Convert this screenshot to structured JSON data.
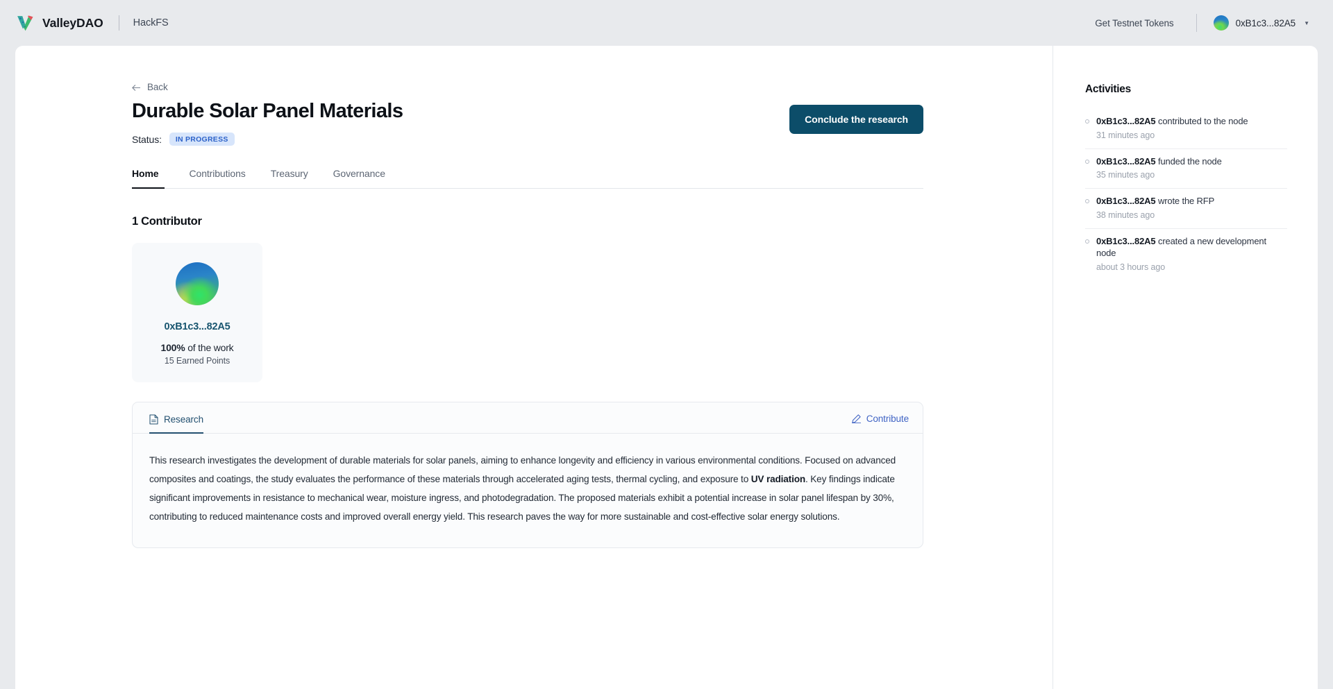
{
  "topbar": {
    "logo_icon": "valleydao-checkmark-logo",
    "brand_name": "ValleyDAO",
    "brand_sub": "HackFS",
    "testnet_link": "Get Testnet Tokens",
    "wallet_address": "0xB1c3...82A5",
    "caret_icon": "chevron-down-icon"
  },
  "page": {
    "back_label": "Back",
    "back_icon": "arrow-left-icon",
    "title": "Durable Solar Panel Materials",
    "status_label": "Status:",
    "status_value": "IN PROGRESS",
    "conclude_button": "Conclude the research"
  },
  "tabs": [
    {
      "label": "Home",
      "active": true
    },
    {
      "label": "Contributions",
      "active": false
    },
    {
      "label": "Treasury",
      "active": false
    },
    {
      "label": "Governance",
      "active": false
    }
  ],
  "contributors": {
    "heading": "1 Contributor",
    "cards": [
      {
        "avatar": "gradient-sphere-avatar",
        "address": "0xB1c3...82A5",
        "work_percent": "100%",
        "work_suffix": " of the work",
        "points": "15 Earned Points"
      }
    ]
  },
  "research": {
    "tab_label": "Research",
    "tab_icon": "document-icon",
    "contribute_label": "Contribute",
    "contribute_icon": "pencil-icon",
    "body_part1": "This research investigates the development of durable materials for solar panels, aiming to enhance longevity and efficiency in various environmental conditions. Focused on advanced composites and coatings, the study evaluates the performance of these materials through accelerated aging tests, thermal cycling, and exposure to ",
    "body_bold": "UV radiation",
    "body_part2": ". Key findings indicate significant improvements in resistance to mechanical wear, moisture ingress, and photodegradation. The proposed materials exhibit a potential increase in solar panel lifespan by 30%, contributing to reduced maintenance costs and improved overall energy yield. This research paves the way for more sustainable and cost-effective solar energy solutions."
  },
  "activities": {
    "title": "Activities",
    "items": [
      {
        "actor": "0xB1c3...82A5",
        "action": " contributed to the node",
        "time": "31 minutes ago"
      },
      {
        "actor": "0xB1c3...82A5",
        "action": " funded the node",
        "time": "35 minutes ago"
      },
      {
        "actor": "0xB1c3...82A5",
        "action": " wrote the RFP",
        "time": "38 minutes ago"
      },
      {
        "actor": "0xB1c3...82A5",
        "action": " created a new development node",
        "time": "about 3 hours ago"
      }
    ]
  },
  "colors": {
    "page_bg": "#e8eaed",
    "card_bg": "#ffffff",
    "accent_dark": "#0c4d69",
    "badge_bg": "#d7e5fb",
    "badge_text": "#2c62c9",
    "link_blue": "#3f63c4",
    "address_teal": "#18556f"
  }
}
